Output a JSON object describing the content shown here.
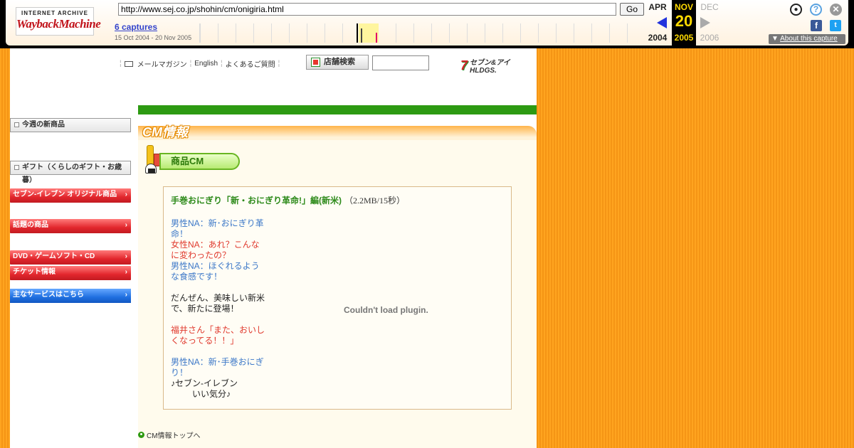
{
  "wayback": {
    "logo_top": "INTERNET ARCHIVE",
    "logo_main": "WaybackMachine",
    "url": "http://www.sej.co.jp/shohin/cm/onigiria.html",
    "go_label": "Go",
    "captures_label": "6 captures",
    "date_range": "15 Oct 2004 - 20 Nov 2005",
    "prev_month": "APR",
    "cur_month": "NOV",
    "next_month": "DEC",
    "cur_day": "20",
    "prev_year": "2004",
    "cur_year": "2005",
    "next_year": "2006",
    "about_label": "About this capture",
    "colors": {
      "accent": "#ffda00",
      "link": "#3344cc"
    }
  },
  "header": {
    "mail_label": "メールマガジン",
    "english_label": "English",
    "faq_label": "よくあるご質問",
    "store_search_label": "店舗検索",
    "store_input_value": "",
    "logo_label": "セブン&アイ HLDGS."
  },
  "sidebar": {
    "items": [
      {
        "label": "今週の新商品"
      },
      {
        "label": "ギフト（くらしのギフト・お歳暮）"
      },
      {
        "label": "セブン-イレブン オリジナル商品"
      },
      {
        "label": "話題の商品"
      },
      {
        "label": "DVD・ゲームソフト・CD"
      },
      {
        "label": "チケット情報"
      },
      {
        "label": "主なサービスはこちら"
      }
    ]
  },
  "main": {
    "section_title": "CM情報",
    "subsection_label": "商品CM",
    "cm": {
      "title": "手巻おにぎり「新・おにぎり革命!」編(新米)",
      "size": "（2.2MB/15秒）",
      "script": [
        "男性NA：新･おにぎり革",
        "命！",
        "女性NA：あれ？こんな",
        "に変わったの？",
        "男性NA：ほぐれるよう",
        "な食感です！",
        "だんぜん、美味しい新米",
        "で、新たに登場！",
        "福井さん「また、おいし",
        "くなってる！！」",
        "男性NA：新･手巻おにぎ",
        "り！",
        "♪セブン-イレブン",
        "いい気分♪"
      ],
      "plugin_message": "Couldn't load plugin."
    },
    "back_link": "CM情報トップへ"
  }
}
